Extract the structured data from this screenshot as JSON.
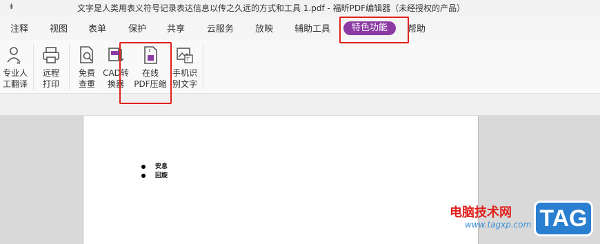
{
  "window": {
    "title": "文字是人类用表义符号记录表达信息以传之久远的方式和工具 1.pdf - 福昕PDF编辑器（未经授权的产品）",
    "quick_access_glyph": "⇟"
  },
  "menu": {
    "tabs": [
      "注释",
      "视图",
      "表单",
      "保护",
      "共享",
      "云服务",
      "放映",
      "辅助工具",
      "特色功能",
      "帮助"
    ],
    "active_tab": "特色功能"
  },
  "ribbon": {
    "buttons": [
      {
        "label1": "专业人",
        "label2": "工翻译",
        "icon": "human-translate-icon"
      },
      {
        "label1": "远程",
        "label2": "打印",
        "icon": "printer-icon"
      },
      {
        "label1": "免费",
        "label2": "查重",
        "icon": "document-check-icon"
      },
      {
        "label1": "CAD转",
        "label2": "换器",
        "icon": "cad-convert-icon"
      },
      {
        "label1": "在线",
        "label2": "PDF压缩",
        "icon": "pdf-compress-icon"
      },
      {
        "label1": "手机识",
        "label2": "别文字",
        "icon": "image-text-ocr-icon"
      }
    ]
  },
  "document": {
    "bullets": [
      "安息",
      "回旋"
    ]
  },
  "watermark": {
    "text": "电脑技术网",
    "url": "www.tagxp.com",
    "badge": "TAG"
  },
  "colors": {
    "accent": "#8b3aa3",
    "highlight": "#e0201c"
  }
}
